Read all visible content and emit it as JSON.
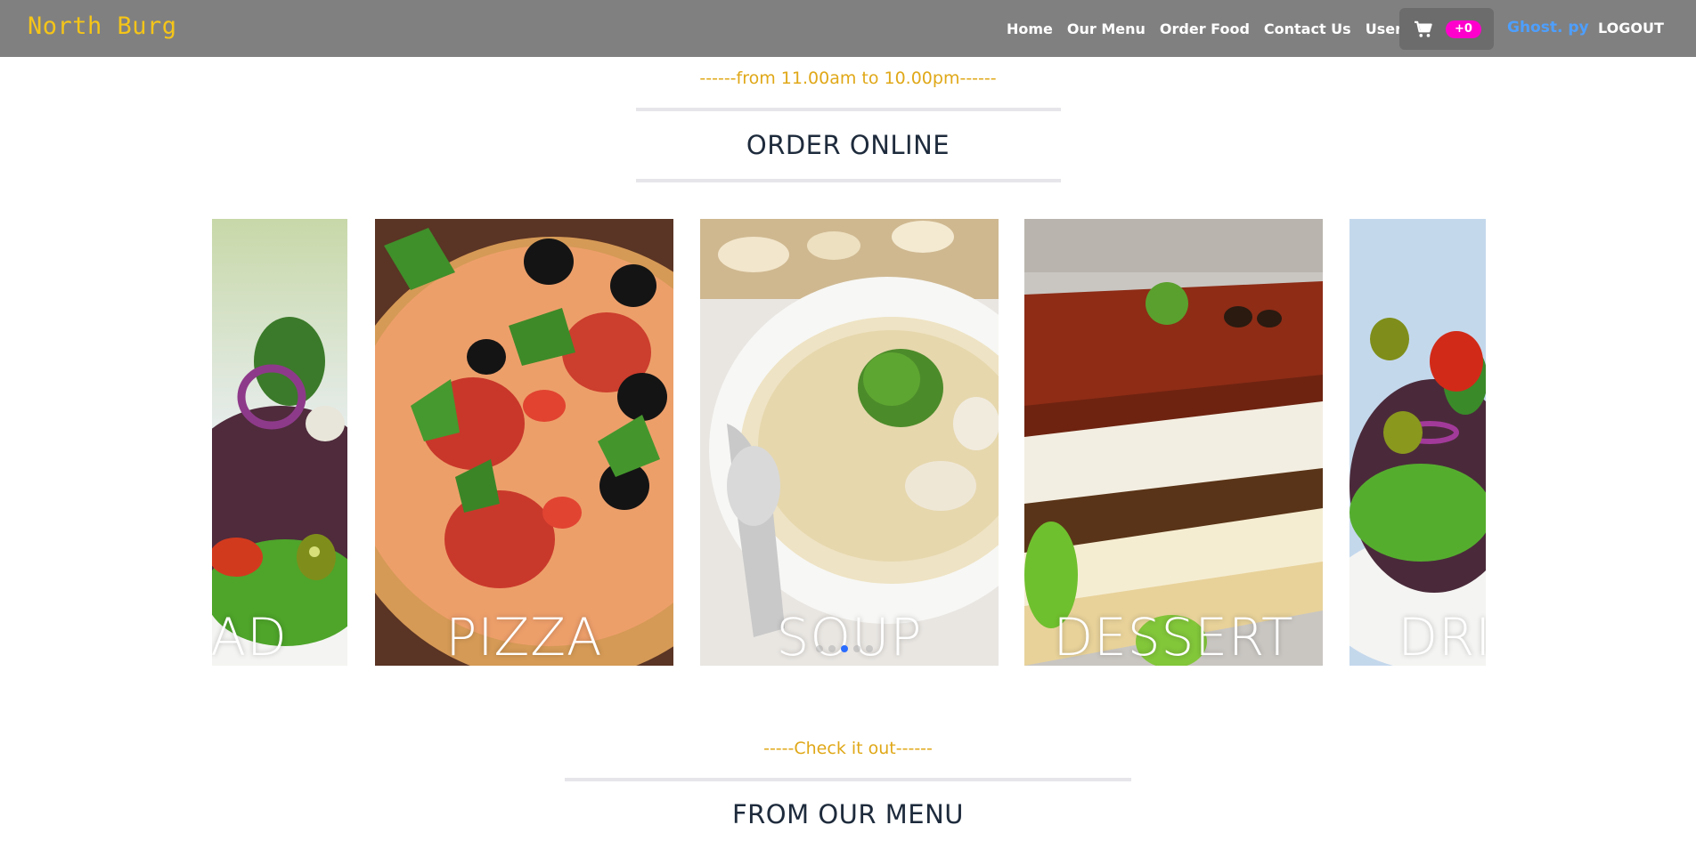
{
  "header": {
    "brand": "North Burg",
    "nav": [
      "Home",
      "Our Menu",
      "Order Food",
      "Contact Us",
      "User Home"
    ],
    "cart_count": "+0",
    "user": "Ghost. py",
    "logout": "LOGOUT"
  },
  "hours": "------from 11.00am to 10.00pm------",
  "order_title": "ORDER ONLINE",
  "carousel": {
    "items": [
      {
        "label": "SALAD",
        "visible": "AD"
      },
      {
        "label": "PIZZA"
      },
      {
        "label": "SOUP"
      },
      {
        "label": "DESSERT"
      },
      {
        "label": "DRINKS",
        "visible": "DR"
      }
    ],
    "active_slide": 3,
    "slide_count": 5
  },
  "check_it_out": "-----Check it out------",
  "menu_title": "FROM OUR MENU",
  "colors": {
    "navbar": "#808080",
    "brand": "#f5c518",
    "accent_text": "#e0a818",
    "user_link": "#4d9fff",
    "cart_badge": "#ff00cc",
    "heading": "#1e2b3c"
  },
  "icons": [
    "cart-icon"
  ]
}
